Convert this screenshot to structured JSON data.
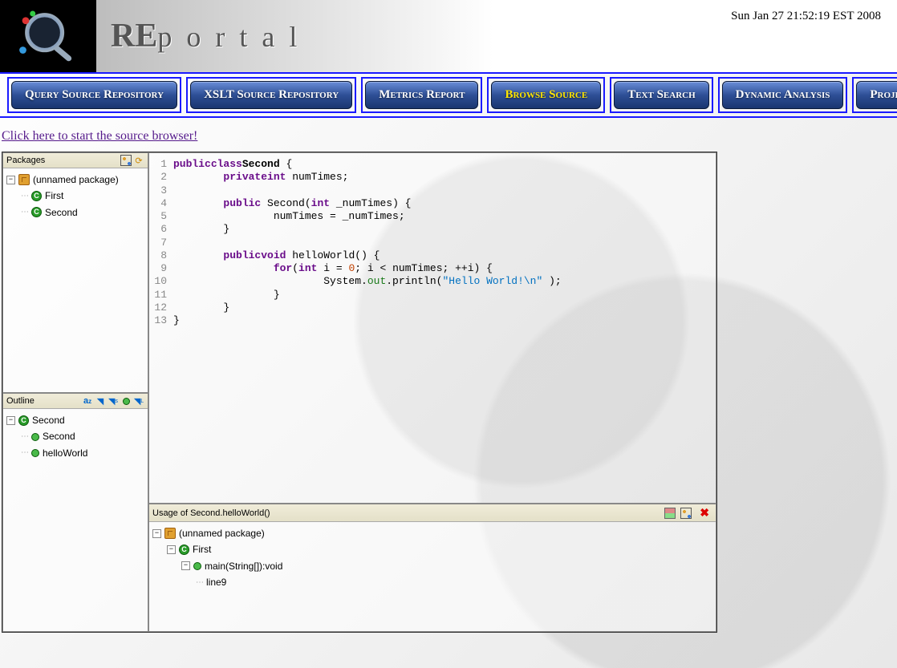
{
  "header": {
    "app_title_prefix": "RE",
    "app_title_suffix": "portal",
    "timestamp": "Sun Jan 27 21:52:19 EST 2008"
  },
  "nav": {
    "items": [
      {
        "label": "Query Source Repository",
        "active": false
      },
      {
        "label": "XSLT Source Repository",
        "active": false
      },
      {
        "label": "Metrics Report",
        "active": false
      },
      {
        "label": "Browse Source",
        "active": true
      },
      {
        "label": "Text Search",
        "active": false
      },
      {
        "label": "Dynamic Analysis",
        "active": false
      },
      {
        "label": "Projects",
        "active": false
      }
    ]
  },
  "link": {
    "start_browser": "Click here to start the source browser!"
  },
  "packages": {
    "title": "Packages",
    "root": "(unnamed package)",
    "items": [
      "First",
      "Second"
    ]
  },
  "outline": {
    "title": "Outline",
    "root": "Second",
    "items": [
      "Second",
      "helloWorld"
    ]
  },
  "usage": {
    "title": "Usage of Second.helloWorld()",
    "root": "(unnamed package)",
    "cls": "First",
    "method": "main(String[]):void",
    "line": "line9"
  },
  "code": {
    "lines": [
      {
        "n": 1,
        "tokens": [
          [
            "kw-mod",
            "public"
          ],
          [
            "",
            ""
          ],
          [
            "kw-mod",
            "class"
          ],
          [
            "",
            ""
          ],
          [
            "cls-name",
            "Second"
          ],
          [
            "",
            " {"
          ]
        ]
      },
      {
        "n": 2,
        "tokens": [
          [
            "",
            "        "
          ],
          [
            "kw-mod",
            "private"
          ],
          [
            "",
            ""
          ],
          [
            "kw-type",
            "int"
          ],
          [
            "",
            " numTimes;"
          ]
        ]
      },
      {
        "n": 3,
        "tokens": [
          [
            "",
            ""
          ]
        ]
      },
      {
        "n": 4,
        "tokens": [
          [
            "",
            "        "
          ],
          [
            "kw-mod",
            "public"
          ],
          [
            "",
            " Second("
          ],
          [
            "kw-type",
            "int"
          ],
          [
            "",
            " _numTimes) {"
          ]
        ]
      },
      {
        "n": 5,
        "tokens": [
          [
            "",
            "                numTimes = _numTimes;"
          ]
        ]
      },
      {
        "n": 6,
        "tokens": [
          [
            "",
            "        }"
          ]
        ]
      },
      {
        "n": 7,
        "tokens": [
          [
            "",
            ""
          ]
        ]
      },
      {
        "n": 8,
        "tokens": [
          [
            "",
            "        "
          ],
          [
            "kw-mod",
            "public"
          ],
          [
            "",
            ""
          ],
          [
            "kw-type",
            "void"
          ],
          [
            "",
            " helloWorld() {"
          ]
        ]
      },
      {
        "n": 9,
        "tokens": [
          [
            "",
            "                "
          ],
          [
            "kw-ctrl",
            "for"
          ],
          [
            "",
            "("
          ],
          [
            "kw-type",
            "int"
          ],
          [
            "",
            " i = "
          ],
          [
            "num",
            "0"
          ],
          [
            "",
            "; i < numTimes; ++i) {"
          ]
        ]
      },
      {
        "n": 10,
        "tokens": [
          [
            "",
            "                        System."
          ],
          [
            "fld",
            "out"
          ],
          [
            "",
            ".println("
          ],
          [
            "str",
            "\"Hello World!\\n\""
          ],
          [
            "",
            ");"
          ]
        ]
      },
      {
        "n": 11,
        "tokens": [
          [
            "",
            "                }"
          ]
        ]
      },
      {
        "n": 12,
        "tokens": [
          [
            "",
            "        }"
          ]
        ]
      },
      {
        "n": 13,
        "tokens": [
          [
            "",
            "}"
          ]
        ]
      }
    ]
  }
}
